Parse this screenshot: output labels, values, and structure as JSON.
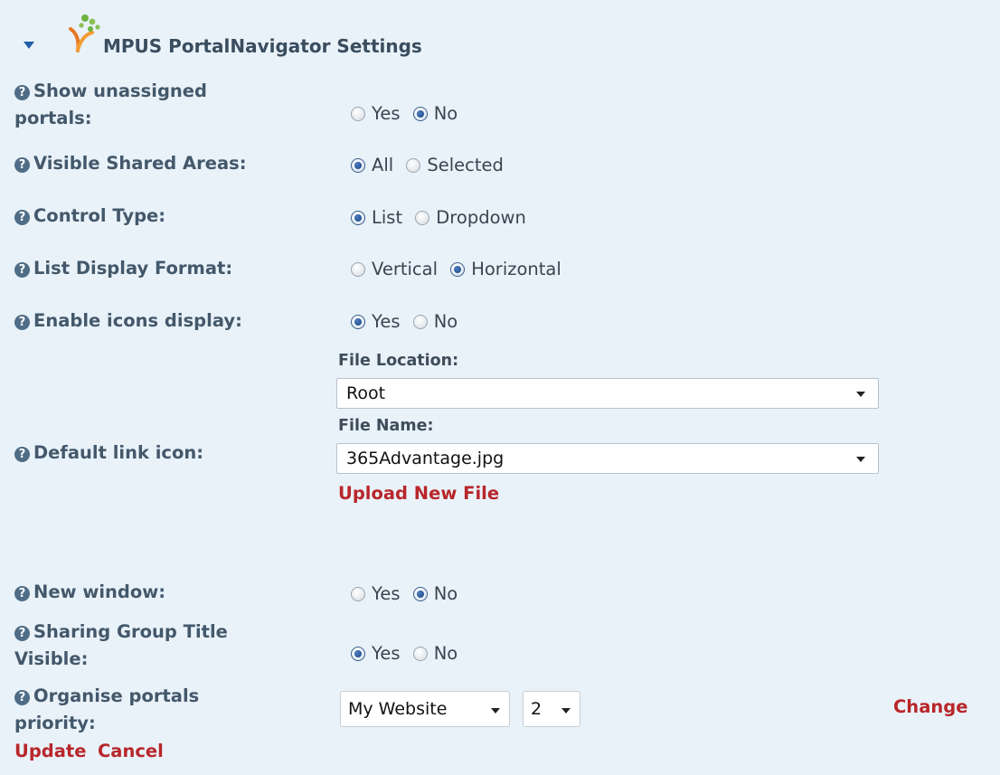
{
  "section": {
    "title": "MPUS PortalNavigator Settings",
    "help_glyph": "?"
  },
  "settings": {
    "show_unassigned": {
      "label_line1": "Show unassigned",
      "label_line2": "portals:",
      "options": [
        {
          "label": "Yes",
          "checked": false
        },
        {
          "label": "No",
          "checked": true
        }
      ]
    },
    "visible_shared_areas": {
      "label": "Visible Shared Areas:",
      "options": [
        {
          "label": "All",
          "checked": true
        },
        {
          "label": "Selected",
          "checked": false
        }
      ]
    },
    "control_type": {
      "label": "Control Type:",
      "options": [
        {
          "label": "List",
          "checked": true
        },
        {
          "label": "Dropdown",
          "checked": false
        }
      ]
    },
    "list_display_format": {
      "label": "List Display Format:",
      "options": [
        {
          "label": "Vertical",
          "checked": false
        },
        {
          "label": "Horizontal",
          "checked": true
        }
      ]
    },
    "enable_icons": {
      "label": "Enable icons display:",
      "options": [
        {
          "label": "Yes",
          "checked": true
        },
        {
          "label": "No",
          "checked": false
        }
      ]
    },
    "default_link_icon": {
      "label": "Default link icon:",
      "file_location_label": "File Location:",
      "file_location_value": "Root",
      "file_name_label": "File Name:",
      "file_name_value": "365Advantage.jpg",
      "upload_label": "Upload New File"
    },
    "new_window": {
      "label": "New window:",
      "options": [
        {
          "label": "Yes",
          "checked": false
        },
        {
          "label": "No",
          "checked": true
        }
      ]
    },
    "sharing_group_title": {
      "label_line1": "Sharing Group Title",
      "label_line2": "Visible:",
      "options": [
        {
          "label": "Yes",
          "checked": true
        },
        {
          "label": "No",
          "checked": false
        }
      ]
    },
    "organise_priority": {
      "label_line1": "Organise portals",
      "label_line2": "priority:",
      "portal_value": "My Website",
      "priority_value": "2",
      "change_label": "Change"
    }
  },
  "footer": {
    "update_label": "Update",
    "cancel_label": "Cancel"
  },
  "colors": {
    "background": "#e9f2f9",
    "label_text": "#44586b",
    "link_red": "#b8262a",
    "radio_checked": "#173f7c"
  }
}
